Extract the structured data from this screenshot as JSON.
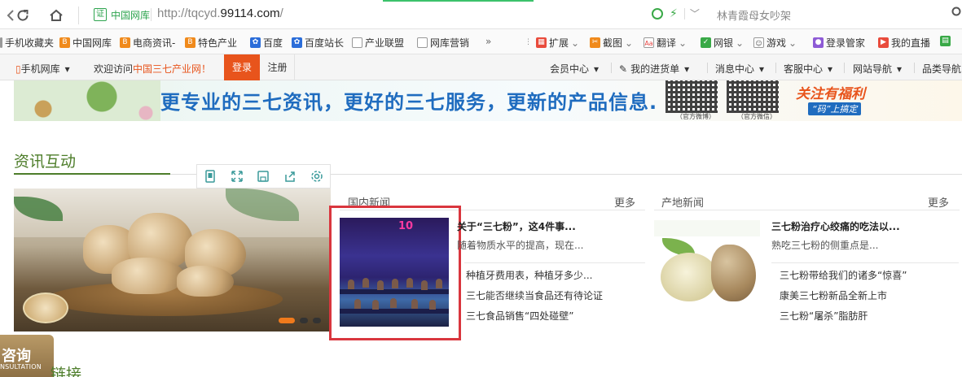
{
  "browser": {
    "site_name": "中国网库",
    "url_prefix": "http://tqcyd.",
    "url_domain": "99114.com",
    "url_suffix": "/",
    "search_text": "林青霞母女吵架",
    "cert_glyph": "证"
  },
  "bookmarks": [
    {
      "label": "手机收藏夹",
      "icon": "folder-icon"
    },
    {
      "label": "中国网库",
      "icon": "site-icon"
    },
    {
      "label": "电商资讯-",
      "icon": "site-icon"
    },
    {
      "label": "特色产业",
      "icon": "site-icon"
    },
    {
      "label": "百度",
      "icon": "baidu-icon"
    },
    {
      "label": "百度站长",
      "icon": "baidu-icon"
    },
    {
      "label": "产业联盟",
      "icon": "page-icon"
    },
    {
      "label": "网库营销",
      "icon": "page-icon"
    },
    {
      "label": "»",
      "icon": ""
    },
    {
      "label": "扩展",
      "icon": "grid-icon"
    },
    {
      "label": "截图",
      "icon": "scissors-icon"
    },
    {
      "label": "翻译",
      "icon": "translate-icon"
    },
    {
      "label": "网银",
      "icon": "shield-icon"
    },
    {
      "label": "游戏",
      "icon": "gamepad-icon"
    },
    {
      "label": "登录管家",
      "icon": "user-icon"
    },
    {
      "label": "我的直播",
      "icon": "live-icon"
    }
  ],
  "sitebar": {
    "mobile": "手机网库",
    "welcome_prefix": "欢迎访问",
    "welcome_highlight": "中国三七产业网！",
    "login": "登录",
    "register": "注册",
    "menu": [
      "会员中心",
      "我的进货单",
      "消息中心",
      "客服中心",
      "网站导航",
      "品类导航"
    ]
  },
  "banner": {
    "slogan": "更专业的三七资讯，更好的三七服务，更新的产品信息.",
    "qr1_caption": "（官方微博）",
    "qr2_caption": "（官方微信）",
    "welfare": "关注有福利",
    "welfare_sub": "“码”上搞定"
  },
  "section": {
    "title": "资讯互动"
  },
  "domestic": {
    "head": "国内新闻",
    "more": "更多",
    "thumb_logo": "10",
    "headline_title": "关于“三七粉”，这4件事...",
    "headline_desc": "随着物质水平的提高，现在...",
    "items": [
      "种植牙费用表，种植牙多少...",
      "三七能否继续当食品还有待论证",
      "三七食品销售“四处碰壁”"
    ]
  },
  "origin": {
    "head": "产地新闻",
    "more": "更多",
    "headline_title": "三七粉治疗心绞痛的吃法以...",
    "headline_desc": "熟吃三七粉的侧重点是...",
    "items": [
      "三七粉带给我们的诸多“惊喜”",
      "康美三七粉新品全新上市",
      "三七粉“屠杀”脂肪肝"
    ]
  },
  "consult": {
    "big": "咨询",
    "small": "NSULTATION"
  },
  "link_section": {
    "title": "链接"
  },
  "colors": {
    "accent_green": "#4d7d2a",
    "login_orange": "#e8541c",
    "highlight_red": "#d9363e"
  }
}
